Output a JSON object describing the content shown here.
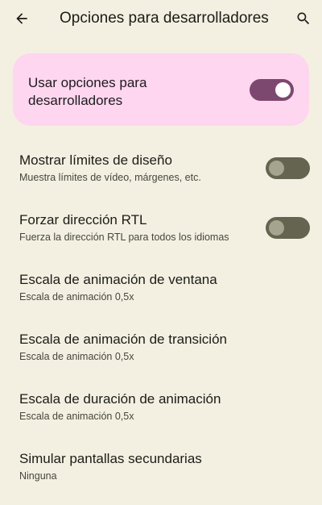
{
  "app_bar": {
    "title": "Opciones para desarrolladores",
    "back_icon": "arrow-back-icon",
    "search_icon": "search-icon"
  },
  "master": {
    "label": "Usar opciones para desarrolladores",
    "enabled": true
  },
  "items": [
    {
      "title": "Mostrar límites de diseño",
      "summary": "Muestra límites de vídeo, márgenes, etc.",
      "has_switch": true,
      "enabled": false
    },
    {
      "title": "Forzar dirección RTL",
      "summary": "Fuerza la dirección RTL para todos los idiomas",
      "has_switch": true,
      "enabled": false
    },
    {
      "title": "Escala de animación de ventana",
      "summary": "Escala de animación 0,5x"
    },
    {
      "title": "Escala de animación de transición",
      "summary": "Escala de animación 0,5x"
    },
    {
      "title": "Escala de duración de animación",
      "summary": "Escala de animación 0,5x"
    },
    {
      "title": "Simular pantallas secundarias",
      "summary": "Ninguna"
    }
  ],
  "colors": {
    "background": "#f3f0e2",
    "master_card": "#fed6ef",
    "switch_on_track": "#7d4870",
    "switch_off_track": "#646450"
  }
}
